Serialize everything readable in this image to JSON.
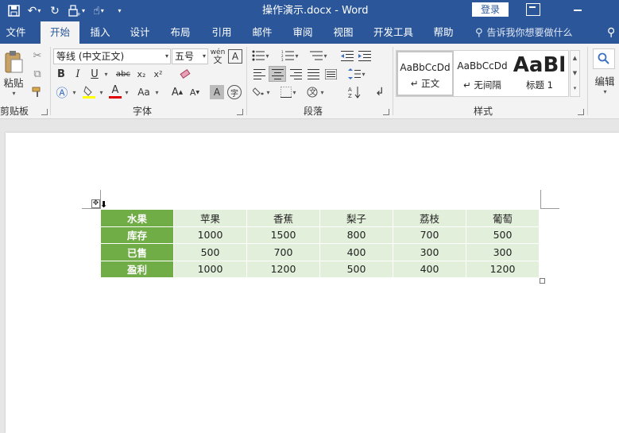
{
  "titlebar": {
    "doc_title": "操作演示.docx  -  Word",
    "login_label": "登录"
  },
  "qat": {
    "icons": [
      "save-icon",
      "undo-icon",
      "redo-icon",
      "print-preview-icon",
      "touch-mode-icon",
      "customize-qat-icon"
    ]
  },
  "tabs": [
    "文件",
    "开始",
    "插入",
    "设计",
    "布局",
    "引用",
    "邮件",
    "审阅",
    "视图",
    "开发工具",
    "帮助"
  ],
  "active_tab": "开始",
  "tellme": {
    "text": "告诉我你想要做什么"
  },
  "ribbon": {
    "clipboard": {
      "paste_label": "粘贴",
      "group_label": "剪贴板"
    },
    "font": {
      "font_name": "等线 (中文正文)",
      "font_size": "五号",
      "group_label": "字体",
      "bold": "B",
      "italic": "I",
      "underline": "U",
      "strike": "abc",
      "subscript": "x₂",
      "superscript": "x²",
      "grow": "A",
      "shrink": "A",
      "change_case": "Aa",
      "char_shading": "A",
      "enclose": "字",
      "phonetic": "wén",
      "char_border": "A"
    },
    "paragraph": {
      "group_label": "段落"
    },
    "styles": {
      "group_label": "样式",
      "items": [
        {
          "preview": "AaBbCcDd",
          "name": "↵ 正文"
        },
        {
          "preview": "AaBbCcDd",
          "name": "↵ 无间隔"
        },
        {
          "preview": "AaBl",
          "name": "标题 1"
        }
      ]
    },
    "editing": {
      "label": "编辑"
    }
  },
  "table": {
    "rows": [
      {
        "header": "水果",
        "values": [
          "苹果",
          "香蕉",
          "梨子",
          "荔枝",
          "葡萄"
        ]
      },
      {
        "header": "库存",
        "values": [
          "1000",
          "1500",
          "800",
          "700",
          "500"
        ]
      },
      {
        "header": "已售",
        "values": [
          "500",
          "700",
          "400",
          "300",
          "300"
        ]
      },
      {
        "header": "盈利",
        "values": [
          "1000",
          "1200",
          "500",
          "400",
          "1200"
        ]
      }
    ]
  },
  "colors": {
    "title_bar": "#2b579a",
    "table_header": "#70ad47",
    "table_cell": "#e2efda"
  }
}
